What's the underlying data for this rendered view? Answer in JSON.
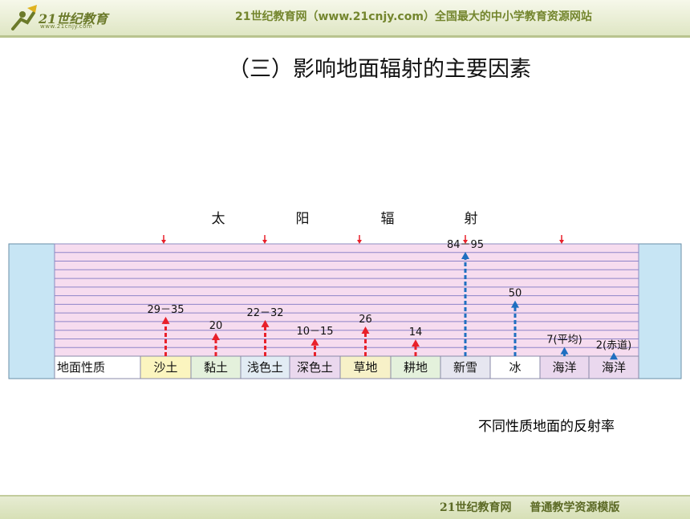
{
  "header": {
    "logo_text": "21世纪教育",
    "logo_sub": "www.21cnjy.com",
    "site_title": "21世纪教育网（www.21cnjy.com）全国最大的中小学教育资源网站"
  },
  "slide_title": "（三）影响地面辐射的主要因素",
  "caption": "不同性质地面的反射率",
  "footer": {
    "left": "21世纪教育网",
    "right": "普通教学资源模版"
  },
  "chart_data": {
    "type": "bar",
    "title_chars": [
      "太",
      "阳",
      "辐",
      "射"
    ],
    "row_header": "地面性质",
    "categories": [
      "沙土",
      "黏土",
      "浅色土",
      "深色土",
      "草地",
      "耕地",
      "新雪",
      "冰",
      "海洋",
      "海洋"
    ],
    "labels": [
      "29－35",
      "20",
      "22－32",
      "10－15",
      "26",
      "14",
      "84－95",
      "50",
      "7(平均)",
      "2(赤道)"
    ],
    "values": [
      35,
      20,
      32,
      15,
      26,
      14,
      95,
      50,
      7,
      2
    ],
    "colors": [
      "#e8202a",
      "#e8202a",
      "#e8202a",
      "#e8202a",
      "#e8202a",
      "#e8202a",
      "#1f6fc0",
      "#1f6fc0",
      "#1f6fc0",
      "#1f6fc0"
    ],
    "cell_colors": [
      "#fbf5bf",
      "#e4f1dc",
      "#e2ecf4",
      "#ead8ee",
      "#f7f1c8",
      "#e4f1dc",
      "#e6e6f0",
      "#ffffff",
      "#ead8ee",
      "#ead8ee"
    ],
    "ylim": [
      0,
      100
    ]
  }
}
